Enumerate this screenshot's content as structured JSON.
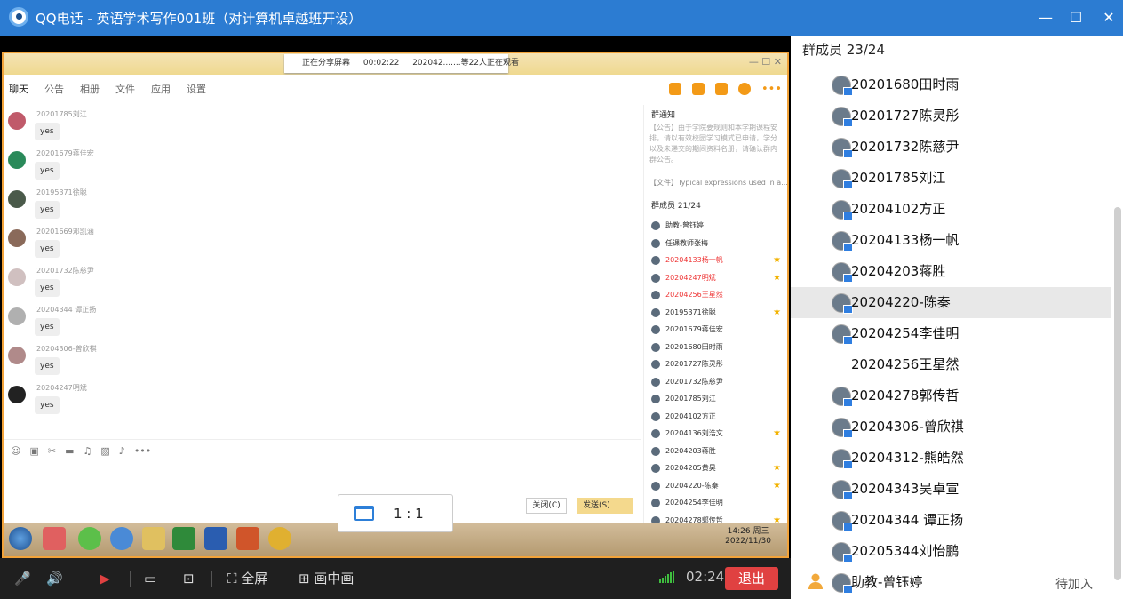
{
  "window": {
    "title": "QQ电话 - 英语学术写作001班（对计算机卓越班开设）",
    "minimize_glyph": "—",
    "maximize_glyph": "☐",
    "close_glyph": "✕"
  },
  "screen_share": {
    "banner_status": "正在分享屏幕",
    "banner_time": "00:02:22",
    "banner_viewers": "202042.......等22人正在观看",
    "top_controls": "— ☐ ✕",
    "tabs": [
      "聊天",
      "公告",
      "相册",
      "文件",
      "应用",
      "设置"
    ],
    "messages": [
      {
        "name": "20201785刘江",
        "text": "yes",
        "color": "#c05a6a"
      },
      {
        "name": "20201679蒋佳宏",
        "text": "yes",
        "color": "#2a8a5a"
      },
      {
        "name": "20195371徐聪",
        "text": "yes",
        "color": "#4a5a4a"
      },
      {
        "name": "20201669邓凯涵",
        "text": "yes",
        "color": "#8a6a5a"
      },
      {
        "name": "20201732陈慈尹",
        "text": "yes",
        "color": "#d0c0c0"
      },
      {
        "name": "20204344 谭正扬",
        "text": "yes",
        "color": "#b0b0b0"
      },
      {
        "name": "20204306-曾欣祺",
        "text": "yes",
        "color": "#b08a8a"
      },
      {
        "name": "20204247明斌",
        "text": "yes",
        "color": "#222222"
      }
    ],
    "notice_title": "群通知",
    "notice_text": "【公告】由于学院要规则和本学期课程安排，请以有效校园学习模式已申请，学分以及未递交的期间资料名册，请确认群内群公告。",
    "file_text": "【文件】Typical expressions used in a...",
    "inner_member_count": "群成员 21/24",
    "inner_members": [
      {
        "name": "助教-曾钰婷",
        "style": "normal",
        "star": ""
      },
      {
        "name": "任课教师张梅",
        "style": "normal",
        "star": ""
      },
      {
        "name": "20204133杨一帆",
        "style": "red",
        "star": "★"
      },
      {
        "name": "20204247明斌",
        "style": "red",
        "star": "★"
      },
      {
        "name": "20204256王星然",
        "style": "red",
        "star": ""
      },
      {
        "name": "20195371徐聪",
        "style": "normal",
        "star": "★"
      },
      {
        "name": "20201679蒋佳宏",
        "style": "normal",
        "star": ""
      },
      {
        "name": "20201680田时雨",
        "style": "normal",
        "star": ""
      },
      {
        "name": "20201727陈灵彤",
        "style": "normal",
        "star": ""
      },
      {
        "name": "20201732陈慈尹",
        "style": "normal",
        "star": ""
      },
      {
        "name": "20201785刘江",
        "style": "normal",
        "star": ""
      },
      {
        "name": "20204102方正",
        "style": "normal",
        "star": ""
      },
      {
        "name": "20204136刘浩文",
        "style": "normal",
        "star": "★"
      },
      {
        "name": "20204203蒋胜",
        "style": "normal",
        "star": ""
      },
      {
        "name": "20204205黄昊",
        "style": "normal",
        "star": "★"
      },
      {
        "name": "20204220-陈秦",
        "style": "normal",
        "star": "★"
      },
      {
        "name": "20204254李佳明",
        "style": "normal",
        "star": ""
      },
      {
        "name": "20204278郭传哲",
        "style": "normal",
        "star": "★"
      }
    ],
    "close_label": "关闭(C)",
    "send_label": "发送(S)",
    "clock_time": "14:26 周三",
    "clock_date": "2022/11/30"
  },
  "ratio_popup": {
    "label": "1 : 1"
  },
  "toolbar": {
    "fullscreen_label": "全屏",
    "pip_label": "画中画",
    "timer": "02:24",
    "exit_label": "退出"
  },
  "members": {
    "header": "群成员 23/24",
    "list": [
      {
        "name": "20201680田时雨",
        "status": "",
        "avatar": true
      },
      {
        "name": "20201727陈灵彤",
        "status": "",
        "avatar": true
      },
      {
        "name": "20201732陈慈尹",
        "status": "",
        "avatar": true
      },
      {
        "name": "20201785刘江",
        "status": "",
        "avatar": true
      },
      {
        "name": "20204102方正",
        "status": "",
        "avatar": true
      },
      {
        "name": "20204133杨一帆",
        "status": "",
        "avatar": true
      },
      {
        "name": "20204203蒋胜",
        "status": "",
        "avatar": true
      },
      {
        "name": "20204220-陈秦",
        "status": "",
        "avatar": true,
        "highlight": true
      },
      {
        "name": "20204254李佳明",
        "status": "",
        "avatar": true
      },
      {
        "name": "20204256王星然",
        "status": "",
        "avatar": false
      },
      {
        "name": "20204278郭传哲",
        "status": "",
        "avatar": true
      },
      {
        "name": "20204306-曾欣祺",
        "status": "",
        "avatar": true
      },
      {
        "name": "20204312-熊皓然",
        "status": "",
        "avatar": true
      },
      {
        "name": "20204343吴卓宣",
        "status": "",
        "avatar": true
      },
      {
        "name": "20204344 谭正扬",
        "status": "",
        "avatar": true
      },
      {
        "name": "20205344刘怡鹏",
        "status": "",
        "avatar": true
      },
      {
        "name": "助教-曾钰婷",
        "status": "待加入",
        "avatar": true,
        "user_icon": true
      }
    ]
  },
  "colors": {
    "titlebar": "#2c7cd2",
    "exit": "#e04141",
    "highlight_row": "#e8e8e8"
  }
}
